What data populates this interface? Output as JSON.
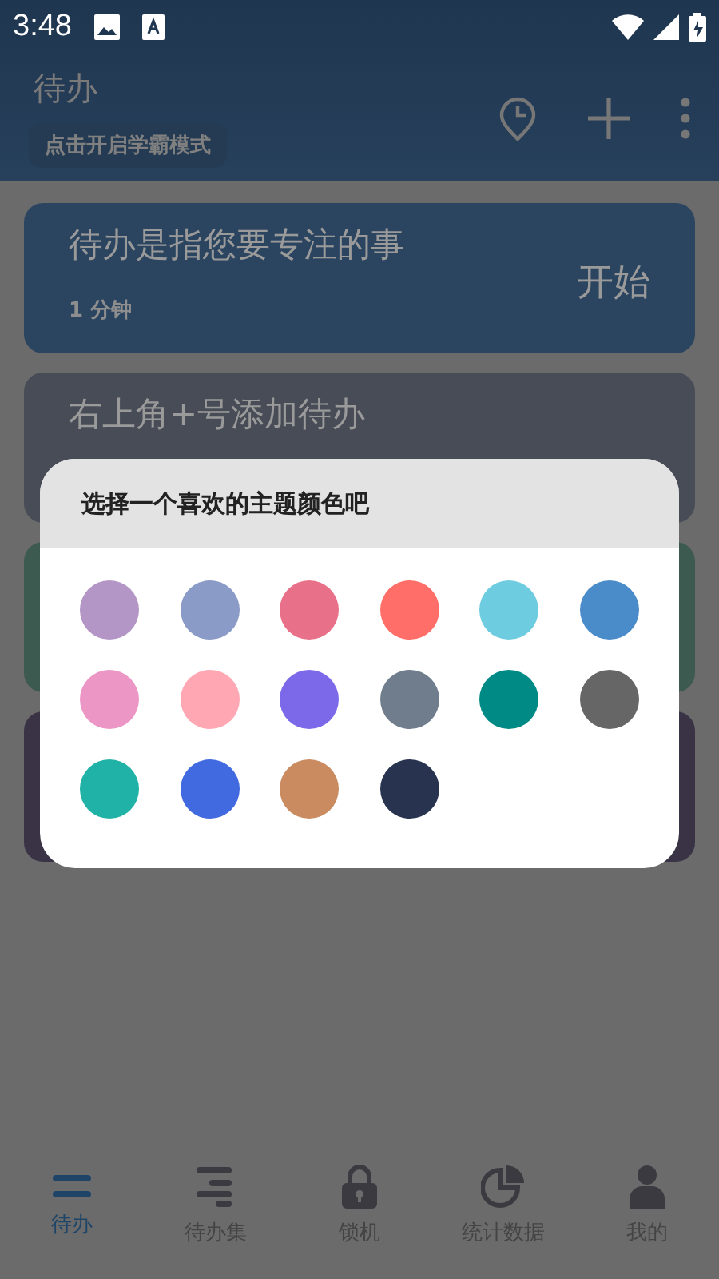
{
  "status_bar": {
    "time": "3:48"
  },
  "app_bar": {
    "title": "待办",
    "chip": "点击开启学霸模式"
  },
  "cards": [
    {
      "title": "待办是指您要专注的事",
      "duration": "1 分钟",
      "action": "开始",
      "color": "#2b4561"
    },
    {
      "title": "右上角+号添加待办",
      "color": "#474c56"
    },
    {
      "color": "#3d5a50"
    },
    {
      "color": "#3a3346"
    }
  ],
  "dialog": {
    "title": "选择一个喜欢的主题颜色吧",
    "colors": [
      {
        "color": "#b395c6"
      },
      {
        "color": "#8b9bc7"
      },
      {
        "color": "#e87088"
      },
      {
        "color": "#ff6e68"
      },
      {
        "color": "#6ecce0"
      },
      {
        "color": "#4a8bca"
      },
      {
        "color": "#ec96c6"
      },
      {
        "color": "#ffa8b4"
      },
      {
        "color": "#7b69ea"
      },
      {
        "color": "#6f7d8d"
      },
      {
        "color": "#008a86"
      },
      {
        "color": "#666666"
      },
      {
        "color": "#20b2a6"
      },
      {
        "color": "#4169e0"
      },
      {
        "color": "#c98b5f"
      },
      {
        "color": "#283350"
      }
    ]
  },
  "bottom_nav": [
    {
      "label": "待办",
      "kind": "list",
      "selected": true
    },
    {
      "label": "待办集",
      "kind": "lines",
      "selected": false
    },
    {
      "label": "锁机",
      "kind": "lock",
      "selected": false
    },
    {
      "label": "统计数据",
      "kind": "pie",
      "selected": false
    },
    {
      "label": "我的",
      "kind": "person",
      "selected": false
    }
  ]
}
